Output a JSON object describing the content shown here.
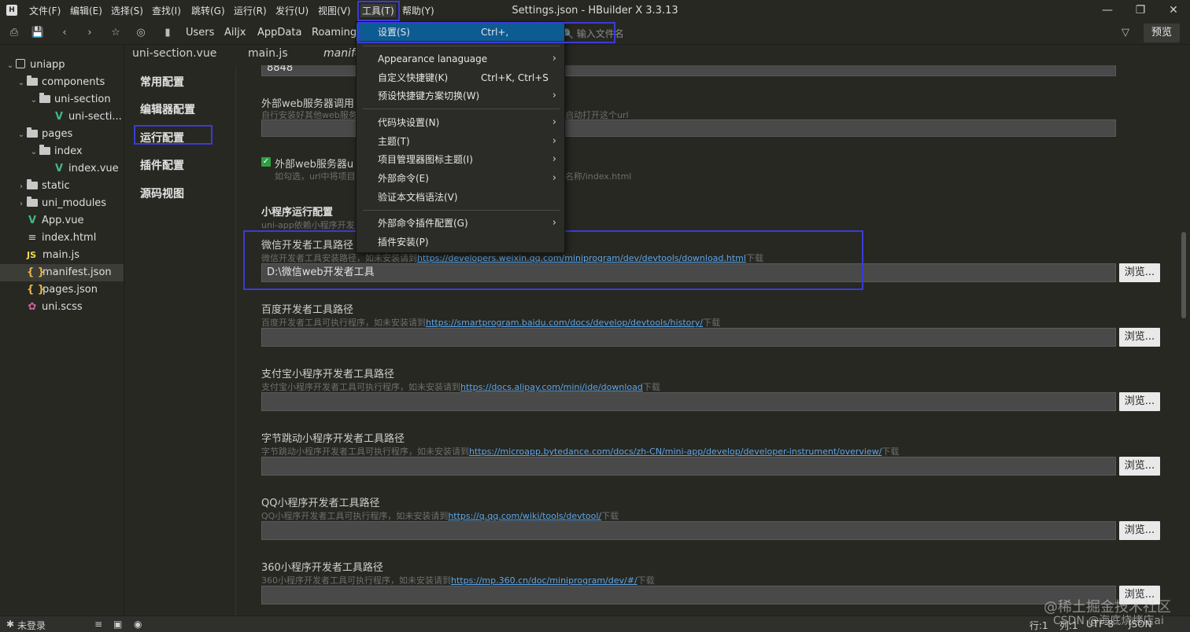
{
  "window": {
    "title": "Settings.json - HBuilder X 3.3.13",
    "menu": [
      "文件(F)",
      "编辑(E)",
      "选择(S)",
      "查找(I)",
      "跳转(G)",
      "运行(R)",
      "发行(U)",
      "视图(V)",
      "工具(T)",
      "帮助(Y)"
    ]
  },
  "toolbar": {
    "breadcrumb": [
      "Users",
      "Ailjx",
      "AppData",
      "Roaming"
    ],
    "search_placeholder": "输入文件名",
    "preview_label": "预览"
  },
  "sidebar": {
    "project": "uniapp",
    "items": [
      {
        "label": "uniapp",
        "type": "project"
      },
      {
        "label": "components",
        "type": "folder"
      },
      {
        "label": "uni-section",
        "type": "folder"
      },
      {
        "label": "uni-secti...",
        "type": "vue"
      },
      {
        "label": "pages",
        "type": "folder"
      },
      {
        "label": "index",
        "type": "folder"
      },
      {
        "label": "index.vue",
        "type": "vue"
      },
      {
        "label": "static",
        "type": "folder"
      },
      {
        "label": "uni_modules",
        "type": "folder"
      },
      {
        "label": "App.vue",
        "type": "vue"
      },
      {
        "label": "index.html",
        "type": "html"
      },
      {
        "label": "main.js",
        "type": "js"
      },
      {
        "label": "manifest.json",
        "type": "json"
      },
      {
        "label": "pages.json",
        "type": "json"
      },
      {
        "label": "uni.scss",
        "type": "scss"
      }
    ]
  },
  "tabs": [
    "uni-section.vue",
    "main.js",
    "manife"
  ],
  "settings_nav": [
    "常用配置",
    "编辑器配置",
    "运行配置",
    "插件配置",
    "源码视图"
  ],
  "content": {
    "top_value": "8848",
    "ext_web_label": "外部web服务器调用",
    "ext_web_hint": "自行安装好其他web服务",
    "ext_web_hint_tail": "启动打开这个url",
    "ext_web_check_label": "外部web服务器u",
    "ext_web_check_hint": "如勾选，url中将项目",
    "ext_web_check_hint_tail": "名称/index.html",
    "mini_section": "小程序运行配置",
    "mini_section_hint": "uni-app依赖小程序开发",
    "tools": [
      {
        "label": "微信开发者工具路径",
        "hint": "微信开发者工具安装路径，如未安装请到",
        "link": "https://developers.weixin.qq.com/miniprogram/dev/devtools/download.html",
        "tail": "下载",
        "value": "D:\\微信web开发者工具",
        "browse": "浏览..."
      },
      {
        "label": "百度开发者工具路径",
        "hint": "百度开发者工具可执行程序，如未安装请到",
        "link": "https://smartprogram.baidu.com/docs/develop/devtools/history/",
        "tail": "下载",
        "value": "",
        "browse": "浏览..."
      },
      {
        "label": "支付宝小程序开发者工具路径",
        "hint": "支付宝小程序开发者工具可执行程序，如未安装请到",
        "link": "https://docs.alipay.com/mini/ide/download",
        "tail": "下载",
        "value": "",
        "browse": "浏览..."
      },
      {
        "label": "字节跳动小程序开发者工具路径",
        "hint": "字节跳动小程序开发者工具可执行程序，如未安装请到",
        "link": "https://microapp.bytedance.com/docs/zh-CN/mini-app/develop/developer-instrument/overview/",
        "tail": "下载",
        "value": "",
        "browse": "浏览..."
      },
      {
        "label": "QQ小程序开发者工具路径",
        "hint": "QQ小程序开发者工具可执行程序，如未安装请到",
        "link": "https://q.qq.com/wiki/tools/devtool/",
        "tail": "下载",
        "value": "",
        "browse": "浏览..."
      },
      {
        "label": "360小程序开发者工具路径",
        "hint": "360小程序开发者工具可执行程序，如未安装请到",
        "link": "https://mp.360.cn/doc/miniprogram/dev/#/",
        "tail": "下载",
        "value": "",
        "browse": "浏览..."
      }
    ]
  },
  "dropdown": [
    {
      "label": "设置(S)",
      "shortcut": "Ctrl+,",
      "arrow": ""
    },
    {
      "label": "Appearance lanaguage",
      "shortcut": "",
      "arrow": "›"
    },
    {
      "label": "自定义快捷键(K)",
      "shortcut": "Ctrl+K, Ctrl+S",
      "arrow": ""
    },
    {
      "label": "预设快捷键方案切换(W)",
      "shortcut": "",
      "arrow": "›"
    },
    {
      "label": "代码块设置(N)",
      "shortcut": "",
      "arrow": "›"
    },
    {
      "label": "主题(T)",
      "shortcut": "",
      "arrow": "›"
    },
    {
      "label": "项目管理器图标主题(I)",
      "shortcut": "",
      "arrow": "›"
    },
    {
      "label": "外部命令(E)",
      "shortcut": "",
      "arrow": "›"
    },
    {
      "label": "验证本文档语法(V)",
      "shortcut": "",
      "arrow": ""
    },
    {
      "label": "外部命令插件配置(G)",
      "shortcut": "",
      "arrow": "›"
    },
    {
      "label": "插件安装(P)",
      "shortcut": "",
      "arrow": ""
    }
  ],
  "status": {
    "login": "未登录",
    "line": "行:1",
    "col": "列:1",
    "encoding": "UTF-8",
    "lang": "JSON"
  },
  "watermark": {
    "line1": "@稀土掘金技术社区",
    "line2": "CSDN @海底烧烤店ai"
  },
  "colors": {
    "bg": "#272822",
    "menu_highlight": "#094771",
    "annotation_border": "#3b3bd6",
    "link": "#5ea5e8"
  }
}
